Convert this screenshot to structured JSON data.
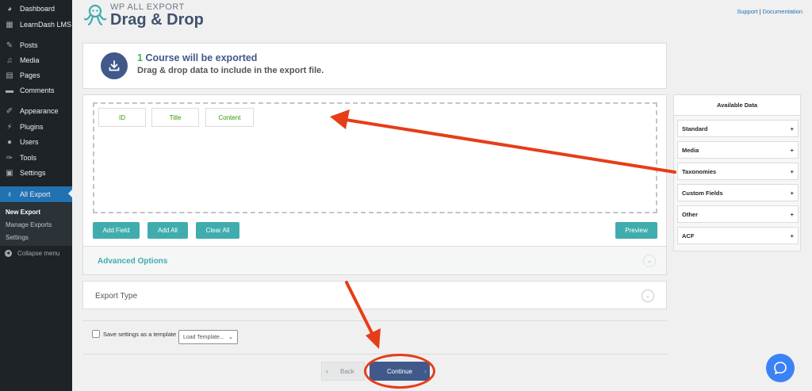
{
  "sidebar": {
    "items": [
      {
        "label": "Dashboard",
        "icon": "dashboard-icon"
      },
      {
        "label": "LearnDash LMS",
        "icon": "learndash-icon"
      },
      {
        "label": "Posts",
        "icon": "pin-icon"
      },
      {
        "label": "Media",
        "icon": "media-icon"
      },
      {
        "label": "Pages",
        "icon": "pages-icon"
      },
      {
        "label": "Comments",
        "icon": "comments-icon"
      },
      {
        "label": "Appearance",
        "icon": "brush-icon"
      },
      {
        "label": "Plugins",
        "icon": "plugin-icon"
      },
      {
        "label": "Users",
        "icon": "user-icon"
      },
      {
        "label": "Tools",
        "icon": "wrench-icon"
      },
      {
        "label": "Settings",
        "icon": "settings-icon"
      },
      {
        "label": "All Export",
        "icon": "octopus-icon"
      }
    ],
    "submenu": [
      "New Export",
      "Manage Exports",
      "Settings"
    ],
    "collapse": "Collapse menu"
  },
  "header": {
    "brand_small": "WP ALL EXPORT",
    "brand_big": "Drag & Drop",
    "support": "Support",
    "separator": "|",
    "documentation": "Documentation"
  },
  "info": {
    "count": "1",
    "headline": "Course will be exported",
    "subtitle": "Drag & drop data to include in the export file."
  },
  "fields": [
    "ID",
    "Title",
    "Content"
  ],
  "buttons": {
    "add_field": "Add Field",
    "add_all": "Add All",
    "clear_all": "Clear All",
    "preview": "Preview",
    "back": "Back",
    "continue": "Continue"
  },
  "sections": {
    "advanced": "Advanced Options",
    "export_type": "Export Type"
  },
  "save_template": {
    "label": "Save settings as a template",
    "select_value": "Load Template..."
  },
  "available": {
    "title": "Available Data",
    "items": [
      "Standard",
      "Media",
      "Taxonomies",
      "Custom Fields",
      "Other",
      "ACF"
    ],
    "expand": "+"
  },
  "colors": {
    "accent_teal": "#40acad",
    "brand_blue": "#40598a",
    "annotation_red": "#e63d18"
  }
}
